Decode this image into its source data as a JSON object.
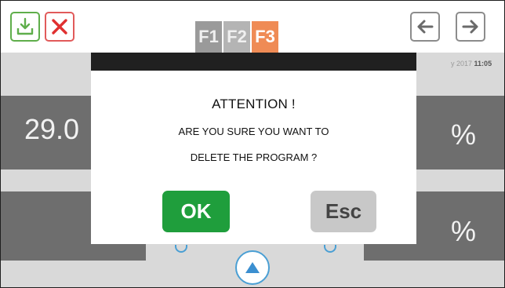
{
  "toolbar": {
    "import_icon": "download-tray-icon",
    "cancel_icon": "red-x-icon",
    "prev_icon": "arrow-left-icon",
    "next_icon": "arrow-right-icon"
  },
  "function_tabs": [
    "F1",
    "F2",
    "F3"
  ],
  "active_tab": "F3",
  "datetime": {
    "date_fragment": "y 2017",
    "time": "11:05"
  },
  "background_values": {
    "left_value": "29.0",
    "percent_1": "%",
    "percent_2": "%"
  },
  "dialog": {
    "title": "ATTENTION !",
    "message_line1": "ARE YOU SURE YOU WANT TO",
    "message_line2": "DELETE THE PROGRAM ?",
    "ok_label": "OK",
    "esc_label": "Esc"
  },
  "colors": {
    "ok_green": "#1f9e3c",
    "esc_gray": "#c8c8c8",
    "active_tab_orange": "#ef8b55",
    "accent_blue": "#4a9fd4",
    "panel_gray": "#6e6e6e"
  },
  "bottom": {
    "play_icon": "triangle-up-icon"
  }
}
